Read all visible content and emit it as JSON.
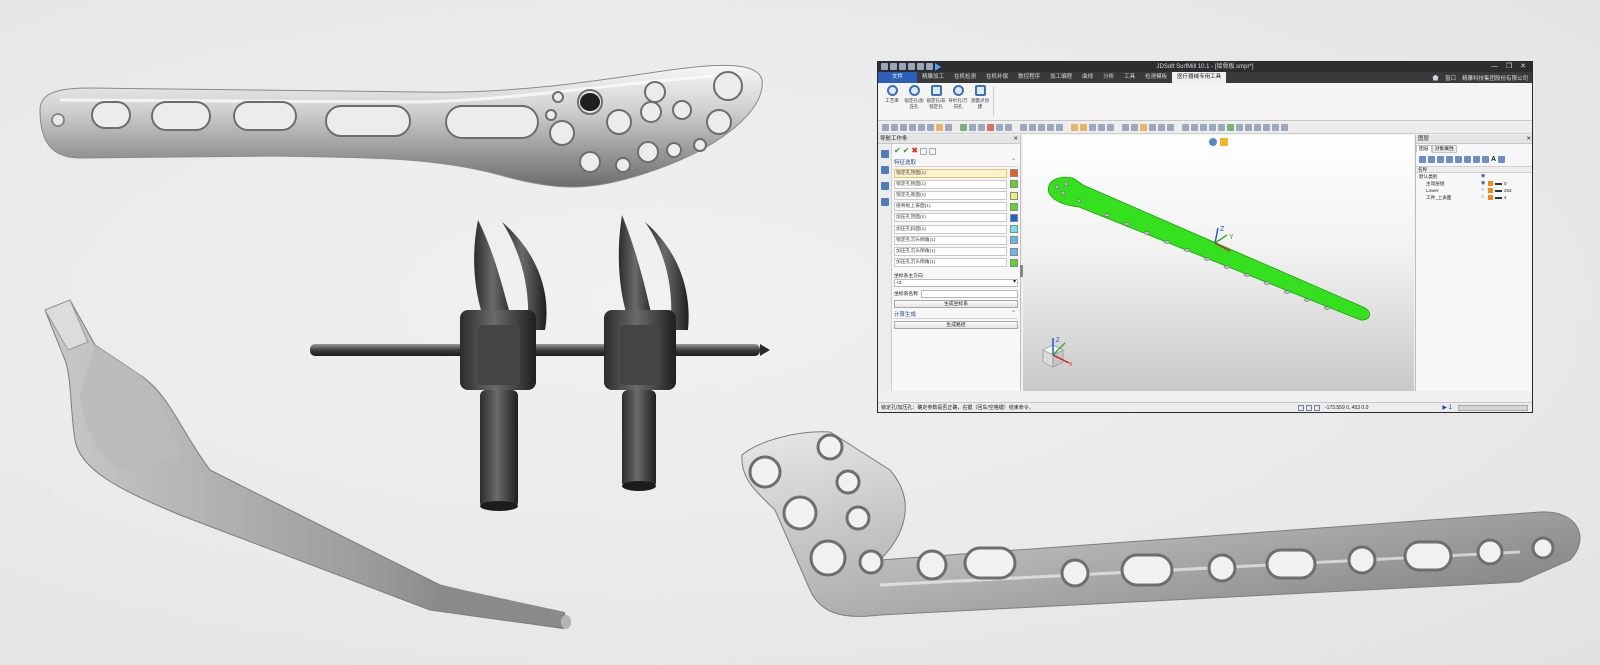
{
  "cad_window": {
    "title": "JDSoft SurfMill 10.1 - [接骨板.smpr*]",
    "window_controls": "— ❐ ✕",
    "menu": {
      "file": "文件",
      "items": [
        "精雕加工",
        "在机检测",
        "在机补偿",
        "数控程序",
        "加工编程",
        "曲线",
        "分析",
        "工具",
        "检测模板"
      ],
      "active": "医疗器械专用工具",
      "right_window": "窗口",
      "right_company": "精雕科技集团股份有限公司"
    },
    "ribbon": [
      {
        "label": "工艺库",
        "icon": "gear-icon"
      },
      {
        "label": "锁定孔/加压孔",
        "icon": "hole-icon"
      },
      {
        "label": "锁定孔/非锁定孔",
        "icon": "slot-icon"
      },
      {
        "label": "导针孔/万向孔",
        "icon": "target-icon"
      },
      {
        "label": "测量点创建",
        "icon": "probe-icon"
      }
    ],
    "nav_panel": {
      "title": "导航工作条",
      "close": "✕",
      "feature_section": "特征选取",
      "features": [
        {
          "label": "锁定孔顶面(1)",
          "color": "#f05a1e"
        },
        {
          "label": "锁定孔侧面(1)",
          "color": "#5fd42e"
        },
        {
          "label": "锁定孔底面(1)",
          "color": "#eef070"
        },
        {
          "label": "接骨板上表面(1)",
          "color": "#5fd42e"
        },
        {
          "label": "加压孔顶面(1)",
          "color": "#1d5fd6"
        },
        {
          "label": "加压孔斜面(1)",
          "color": "#6ee6e6"
        },
        {
          "label": "锁定孔沉头倒角(1)",
          "color": "#67b8e8"
        },
        {
          "label": "加压孔沉头倒角(1)",
          "color": "#67b8e8"
        },
        {
          "label": "加压孔沉头倒角(1)",
          "color": "#5fd42e"
        }
      ],
      "coord_axis_label": "坐标系主方向",
      "coord_axis_value": "+Z",
      "coord_name_label": "坐标系名称",
      "create_coord_button": "生成坐标系",
      "calc_section": "计算生成",
      "generate_button": "生成路径"
    },
    "tree_panel": {
      "title": "图层",
      "tabs": [
        "图层",
        "对象属性"
      ],
      "columns": [
        "名称"
      ],
      "rows": [
        {
          "name": "默认类别",
          "level": 0,
          "color": "",
          "value": ""
        },
        {
          "name": "主动层组",
          "level": 1,
          "color": "",
          "value": "0"
        },
        {
          "name": "Lower",
          "level": 1,
          "color": "#f08a1e",
          "value": "253"
        },
        {
          "name": "工件_上表面",
          "level": 1,
          "color": "#f08a1e",
          "value": "4"
        }
      ]
    },
    "status": {
      "message": "锁定孔/加压孔：确定参数是否正确，右键（回车/空格键）结束命令。",
      "coords": "-173.559 0, 453 0.0",
      "indicator": "▶ 1"
    }
  }
}
